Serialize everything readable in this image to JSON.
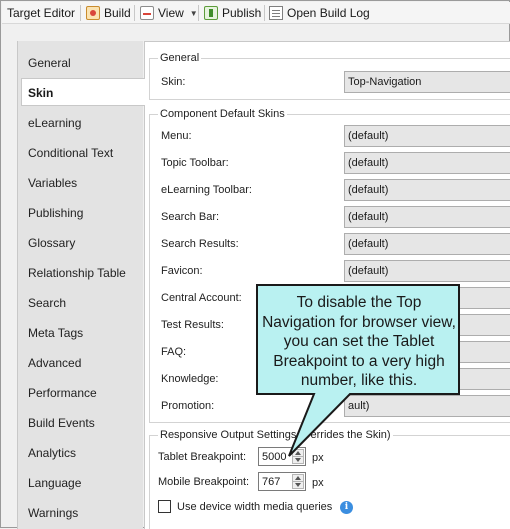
{
  "toolbar": {
    "title": "Target Editor",
    "build": "Build",
    "view": "View",
    "publish": "Publish",
    "open_build_log": "Open Build Log"
  },
  "nav": {
    "selected": "Skin",
    "items": [
      "General",
      "Skin",
      "eLearning",
      "Conditional Text",
      "Variables",
      "Publishing",
      "Glossary",
      "Relationship Table",
      "Search",
      "Meta Tags",
      "Advanced",
      "Performance",
      "Build Events",
      "Analytics",
      "Language",
      "Warnings"
    ]
  },
  "general": {
    "legend": "General",
    "skin_label": "Skin:",
    "skin_value": "Top-Navigation"
  },
  "components": {
    "legend": "Component Default Skins",
    "rows": [
      {
        "label": "Menu:",
        "value": "(default)"
      },
      {
        "label": "Topic Toolbar:",
        "value": "(default)"
      },
      {
        "label": "eLearning Toolbar:",
        "value": "(default)"
      },
      {
        "label": "Search Bar:",
        "value": "(default)"
      },
      {
        "label": "Search Results:",
        "value": "(default)"
      },
      {
        "label": "Favicon:",
        "value": "(default)"
      },
      {
        "label": "Central Account:",
        "value": ""
      },
      {
        "label": "Test Results:",
        "value": ""
      },
      {
        "label": "FAQ:",
        "value": ""
      },
      {
        "label": "Knowledge:",
        "value": ""
      },
      {
        "label": "Promotion:",
        "value": "ault)"
      }
    ]
  },
  "responsive": {
    "legend": "Responsive Output Settings",
    "legend_tail": "verrides the Skin)",
    "tablet_label": "Tablet Breakpoint:",
    "tablet_value": "5000",
    "mobile_label": "Mobile Breakpoint:",
    "mobile_value": "767",
    "unit": "px",
    "checkbox_label": "Use device width media queries",
    "checkbox_checked": false
  },
  "callout": {
    "text": "To disable the Top Navigation for browser view, you can set the Tablet Breakpoint to a very high number, like this.",
    "fill": "#b9f1f1"
  }
}
